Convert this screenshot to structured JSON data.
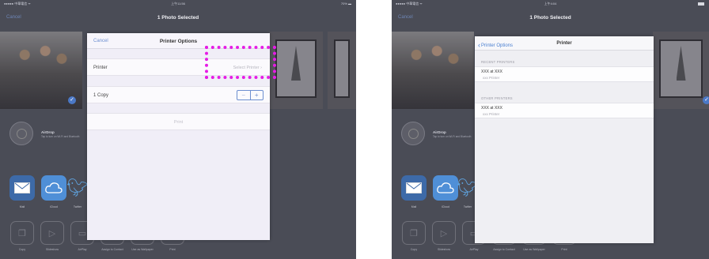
{
  "left": {
    "status": {
      "carrier": "●●●●● 中華電信 ᯤ",
      "time": "上午11:56",
      "battery": "70% ▬"
    },
    "nav": {
      "cancel": "Cancel",
      "title": "1 Photo Selected"
    },
    "airdrop": {
      "name": "AirDrop",
      "subtitle": "Tap to turn on Wi-Fi and Bluetooth"
    },
    "apps": [
      {
        "label": "Mail"
      },
      {
        "label": "iCloud"
      },
      {
        "label": "Twitter"
      }
    ],
    "actions": [
      {
        "label": "Copy"
      },
      {
        "label": "Slideshow"
      },
      {
        "label": "AirPlay"
      },
      {
        "label": "Assign to Contact"
      },
      {
        "label": "Use as Wallpaper"
      },
      {
        "label": "Print"
      }
    ],
    "sheet": {
      "cancel": "Cancel",
      "title": "Printer Options",
      "printer_label": "Printer",
      "printer_value": "Select Printer  ›",
      "copies_label": "1 Copy",
      "stepper_minus": "−",
      "stepper_plus": "+",
      "print": "Print"
    }
  },
  "right": {
    "status": {
      "carrier": "●●●●● 中華電信 ᯤ",
      "time": "上午4:04",
      "battery": ""
    },
    "nav": {
      "cancel": "Cancel",
      "title": "1 Photo Selected"
    },
    "airdrop": {
      "name": "AirDrop",
      "subtitle": "Tap to turn on Wi-Fi and Bluetooth"
    },
    "apps": [
      {
        "label": "Mail"
      },
      {
        "label": "iCloud"
      },
      {
        "label": "Twitter"
      }
    ],
    "actions": [
      {
        "label": "Copy"
      },
      {
        "label": "Slideshow"
      },
      {
        "label": "AirPlay"
      },
      {
        "label": "Assign to Contact"
      },
      {
        "label": "Use as Wallpaper"
      },
      {
        "label": "Print"
      }
    ],
    "sheet": {
      "back": "Printer Options",
      "title": "Printer",
      "recent_header": "RECENT PRINTERS",
      "recent": [
        {
          "name": "XXX at XXX",
          "kind": "xxx Printer"
        }
      ],
      "other_header": "OTHER PRINTERS",
      "other": [
        {
          "name": "XXX at XXX",
          "kind": "xxx Printer"
        }
      ]
    }
  },
  "colors": {
    "highlight": "#e61ce6",
    "ios_blue": "#4a7fd0",
    "dim_background": "#4a4c56"
  }
}
